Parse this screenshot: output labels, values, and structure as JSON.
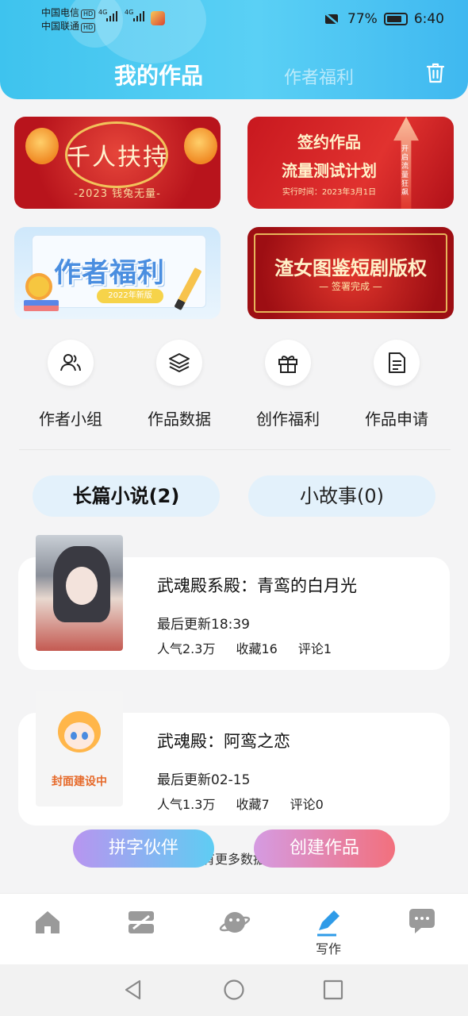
{
  "status_bar": {
    "carrier1": "中国电信",
    "carrier2": "中国联通",
    "hd": "HD",
    "network": "4G",
    "battery": "77%",
    "time": "6:40"
  },
  "header": {
    "tab_active": "我的作品",
    "tab_inactive": "作者福利"
  },
  "banners": [
    {
      "title": "千人扶持",
      "subtitle": "-2023 钱兔无量-"
    },
    {
      "line1": "签约作品",
      "line2": "流量测试计划",
      "line3": "实行时间：2023年3月1日",
      "side": "开启流量狂飙"
    },
    {
      "title": "作者福利",
      "tag": "2022年新版"
    },
    {
      "title": "渣女图鉴短剧版权",
      "subtitle": "— 签署完成 —"
    }
  ],
  "quick_actions": [
    {
      "label": "作者小组",
      "icon": "people-icon"
    },
    {
      "label": "作品数据",
      "icon": "layers-icon"
    },
    {
      "label": "创作福利",
      "icon": "gift-icon"
    },
    {
      "label": "作品申请",
      "icon": "document-icon"
    }
  ],
  "segments": {
    "novel": "长篇小说(2)",
    "story": "小故事(0)"
  },
  "works": [
    {
      "title": "武魂殿系殿：青鸾的白月光",
      "updated": "最后更新18:39",
      "popularity": "人气2.3万",
      "favorites": "收藏16",
      "comments": "评论1"
    },
    {
      "title": "武魂殿：阿鸾之恋",
      "updated": "最后更新02-15",
      "popularity": "人气1.3万",
      "favorites": "收藏7",
      "comments": "评论0",
      "cover_text": "封面建设中"
    }
  ],
  "footer_note": "没有更多数据了",
  "fab": {
    "partner": "拼字伙伴",
    "create": "创建作品"
  },
  "tabbar": {
    "active_label": "写作",
    "icons": [
      "home-icon",
      "library-icon",
      "planet-icon",
      "pen-icon",
      "chat-icon"
    ]
  },
  "colors": {
    "header_blue": "#3ec3ee",
    "segment_bg": "#e3f1fb",
    "active_tab": "#2f9be8"
  }
}
